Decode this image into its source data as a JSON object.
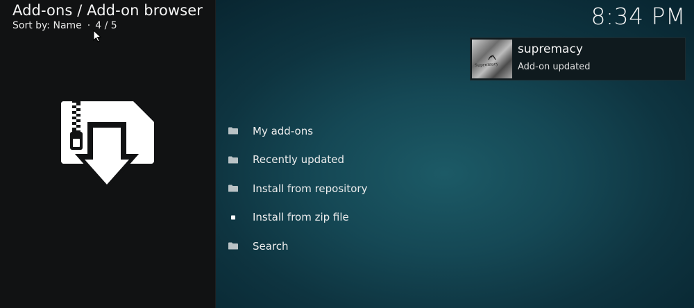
{
  "header": {
    "breadcrumb": "Add-ons / Add-on browser",
    "sort_label": "Sort by: Name",
    "separator": "·",
    "position": "4 / 5",
    "clock": "8:34 PM"
  },
  "notification": {
    "title": "supremacy",
    "subtitle": "Add-on updated",
    "thumbnail_text": "Supremacy"
  },
  "menu": {
    "items": [
      {
        "label": "My add-ons",
        "icon": "folder-icon"
      },
      {
        "label": "Recently updated",
        "icon": "folder-icon"
      },
      {
        "label": "Install from repository",
        "icon": "folder-icon"
      },
      {
        "label": "Install from zip file",
        "icon": "square-bullet-icon"
      },
      {
        "label": "Search",
        "icon": "folder-icon"
      }
    ]
  },
  "preview": {
    "icon": "zip-download-icon"
  },
  "colors": {
    "left_panel": "#111213",
    "background_center": "#1c5a66",
    "background_edge": "#082530",
    "text": "#f2f2f2"
  }
}
